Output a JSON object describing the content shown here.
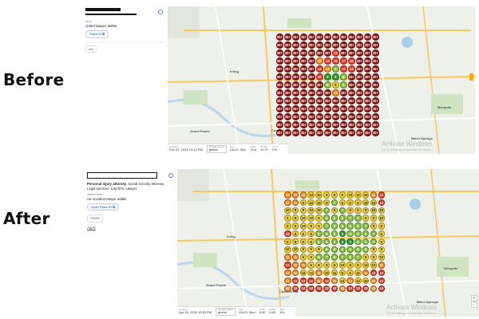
{
  "before": {
    "label": "Before",
    "sidebar": {
      "term_caption": "Term",
      "term_value": "cident lawyer dallas",
      "chip": "Place ID",
      "small_chip": "4/4"
    },
    "footer": {
      "created_caption": "Created",
      "created": "Feb 17, 2025 10:12 PM",
      "google_region_caption": "Google region",
      "google_region": "global",
      "size_caption": "Size",
      "size": "13x13, 3km",
      "agr_caption": "AGR",
      "agr": "15.8",
      "atgr_caption": "ATGR",
      "atgr": "19.47",
      "solv_caption": "SoLV",
      "solv": "0%"
    },
    "grid": [
      [
        "20+",
        "20+",
        "20+",
        "20+",
        "20+",
        "20+",
        "20+",
        "20+",
        "20+",
        "20+",
        "20+",
        "20+",
        "20+"
      ],
      [
        "20+",
        "20+",
        "20+",
        "20+",
        "20+",
        "20+",
        "20+",
        "20+",
        "20+",
        "20+",
        "20+",
        "20+",
        "20+"
      ],
      [
        "20+",
        "20+",
        "20+",
        "20+",
        "20+",
        "20+",
        "20+",
        "13",
        "20+",
        "20+",
        "20+",
        "20+",
        "20+"
      ],
      [
        "20+",
        "20+",
        "20+",
        "20+",
        "20+",
        "12",
        "14",
        "16",
        "17",
        "18",
        "20+",
        "20+",
        "20+"
      ],
      [
        "20+",
        "20+",
        "20+",
        "20+",
        "20+",
        "14",
        "12",
        "4",
        "13",
        "14",
        "20+",
        "20+",
        "20+"
      ],
      [
        "20+",
        "20+",
        "20+",
        "20+",
        "20+",
        "18",
        "3",
        "3",
        "5",
        "20+",
        "20+",
        "20+",
        "20+"
      ],
      [
        "20+",
        "20+",
        "20+",
        "20+",
        "20+",
        "20+",
        "6",
        "9",
        "5",
        "20+",
        "20+",
        "20+",
        "20+"
      ],
      [
        "20+",
        "20+",
        "20+",
        "20+",
        "20+",
        "20+",
        "20+",
        "12",
        "20+",
        "20+",
        "20+",
        "20+",
        "20+"
      ],
      [
        "20+",
        "20+",
        "20+",
        "20+",
        "20+",
        "20+",
        "20+",
        "20+",
        "20+",
        "20+",
        "20+",
        "20+",
        "20+"
      ],
      [
        "20+",
        "20+",
        "20+",
        "20+",
        "20+",
        "20+",
        "20+",
        "20+",
        "20+",
        "20+",
        "20+",
        "20+",
        "20+"
      ],
      [
        "20+",
        "20+",
        "20+",
        "20+",
        "20+",
        "20+",
        "20+",
        "20+",
        "20+",
        "20+",
        "20+",
        "20+",
        "20+"
      ],
      [
        "20+",
        "20+",
        "20+",
        "20+",
        "20+",
        "20+",
        "20+",
        "20+",
        "20+",
        "20+",
        "20+",
        "20+",
        "20+"
      ],
      [
        "20+",
        "20+",
        "20+",
        "20+",
        "20+",
        "20+",
        "20+",
        "20+",
        "20+",
        "20+",
        "20+",
        "20+",
        "20+"
      ]
    ],
    "watermark": "Activate Windows",
    "watermark_sub": "Go to Settings to activate Windows."
  },
  "after": {
    "label": "After",
    "sidebar": {
      "categories_bold": "Personal injury attorney",
      "categories_rest": ", Social security attorney, Legal services, Law firm, Lawyer.",
      "term_caption": "Search term",
      "term_value": "car accident lawyer dallas",
      "chip": "Open Place ID",
      "small_chip": "TRIED",
      "apply_label": "Apply"
    },
    "footer": {
      "created_caption": "Created",
      "created": "Apr 28, 2025 10:53 PM",
      "google_region_caption": "Google region",
      "google_region": "global",
      "size_caption": "Size",
      "size": "13x13, 3km",
      "agr_caption": "AGR",
      "agr": "9.00",
      "atgr_caption": "ATGR",
      "atgr": "9.83",
      "solv_caption": "SoLV",
      "solv": "5%"
    },
    "grid": [
      [
        "12",
        "12",
        "12",
        "10",
        "10",
        "9",
        "9",
        "9",
        "10",
        "10",
        "10",
        "11",
        "13"
      ],
      [
        "11",
        "11",
        "9",
        "10",
        "10",
        "9",
        "7",
        "8",
        "8",
        "9",
        "10",
        "10",
        "13"
      ],
      [
        "10",
        "9",
        "8",
        "10",
        "10",
        "7",
        "8",
        "7",
        "8",
        "8",
        "9",
        "10",
        "10"
      ],
      [
        "9",
        "9",
        "10",
        "10",
        "9",
        "6",
        "5",
        "6",
        "7",
        "7",
        "8",
        "9",
        "10"
      ],
      [
        "9",
        "9",
        "10",
        "8",
        "9",
        "7",
        "6",
        "5",
        "6",
        "6",
        "7",
        "8",
        "9"
      ],
      [
        "13",
        "8",
        "9",
        "8",
        "7",
        "6",
        "5",
        "3",
        "4",
        "5",
        "6",
        "7",
        "9"
      ],
      [
        "9",
        "9",
        "9",
        "8",
        "6",
        "5",
        "4",
        "3",
        "3",
        "4",
        "5",
        "7",
        "9"
      ],
      [
        "10",
        "10",
        "9",
        "9",
        "8",
        "6",
        "5",
        "4",
        "4",
        "5",
        "6",
        "8",
        "9"
      ],
      [
        "11",
        "11",
        "9",
        "8",
        "6",
        "7",
        "6",
        "7",
        "6",
        "7",
        "8",
        "9",
        "10"
      ],
      [
        "13",
        "11",
        "11",
        "9",
        "8",
        "9",
        "8",
        "10",
        "8",
        "9",
        "10",
        "10",
        "11"
      ],
      [
        "12",
        "11",
        "10",
        "10",
        "11",
        "10",
        "10",
        "9",
        "9",
        "10",
        "11",
        "13",
        "13"
      ],
      [
        "11",
        "13",
        "13",
        "13",
        "11",
        "13",
        "11",
        "10",
        "12",
        "10",
        "10",
        "11",
        "13"
      ],
      [
        "12",
        "13",
        "13",
        "13",
        "13",
        "13",
        "13",
        "11",
        "13",
        "13",
        "13",
        "12",
        "13"
      ]
    ],
    "watermark": "Activate Windows",
    "watermark_sub": "Go to Settings to activate Windows."
  },
  "map_labels": [
    "Irving",
    "Dallas",
    "Grand Prairie",
    "Euless",
    "Cockrell Hill",
    "Mesquite",
    "Balch Springs",
    "Dallas Love Field",
    "El Rancho Supermercado",
    "Lake Highlands"
  ],
  "colors": {
    "rank_top": "#2e9d2e",
    "rank_good": "#8bc53f",
    "rank_mid": "#f2d12b",
    "rank_warn": "#f28c28",
    "rank_bad": "#e23b2a",
    "rank_none": "#8c1d1d"
  }
}
